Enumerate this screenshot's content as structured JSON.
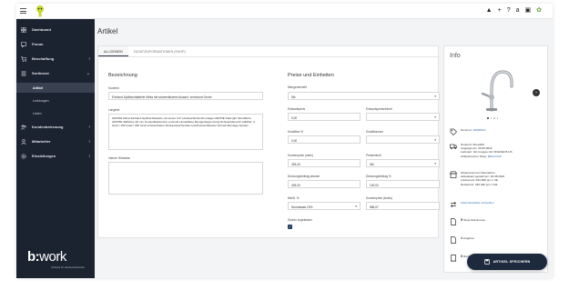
{
  "nav": {
    "items": [
      {
        "label": "Dashboard",
        "icon": "grid-icon"
      },
      {
        "label": "Forum",
        "icon": "chat-icon"
      },
      {
        "label": "Beschaffung",
        "icon": "cart-icon"
      },
      {
        "label": "Sortiment",
        "icon": "sortiment-icon"
      }
    ],
    "subitems": [
      {
        "label": "Artikel",
        "active": true
      },
      {
        "label": "Leistungen"
      },
      {
        "label": "Listen"
      }
    ],
    "items2": [
      {
        "label": "Kundenbetreuung",
        "icon": "people-icon"
      },
      {
        "label": "Mitarbeiter",
        "icon": "person-icon"
      },
      {
        "label": "Einstellungen",
        "icon": "gear-icon"
      }
    ],
    "brand_main": "b:",
    "brand_work": "work",
    "brand_sub": "Software für Handwerksbetriebe"
  },
  "page": {
    "title": "Artikel"
  },
  "tabs": [
    "ALLGEMEIN",
    "ZUSATZINFORMATIONEN (SHOP)"
  ],
  "left": {
    "section": "Bezeichnung",
    "kurztext_label": "Kurztext",
    "kurztext_value": "Einhand-Spültischbatterie Minta mit schwenkbarem Auslauf, verchromt Grohe",
    "langtext_label": "Langtext",
    "langtext_value": "GROHE Minta Einhand-Spültischbatterie mit einem 1/2\"+Auslauf Einlochmontage GROHE StarLight Oberfläche GROHE SilkMove 46 mm Keramikkartusche versenkt einstellbare Mengenbegrenzung Schwenkbereich wählbar: 0 Grad / 150 Grad / 360 Grad schwenkbarer Rohrauslauf flexible Anschlussschläuche Schnell-Montage-System",
    "hints_label": "Interne Hinweise",
    "hints_value": ""
  },
  "right": {
    "section": "Preise und Einheiten",
    "mengeneinheit_label": "Mengeneinheit",
    "mengeneinheit_value": "Stk",
    "einkaufspreis_label": "Einkaufspreis",
    "einkaufspreis_value": "0,00",
    "ekpe_label": "Einkaufspreiseinheit",
    "ekpe_value": "",
    "kondition_label": "Kondition %",
    "kondition_value": "0,00",
    "konditionsart_label": "Konditionsart",
    "konditionsart_value": "",
    "kundenpreis_label": "Kundenpreis (netto)",
    "kundenpreis_value": "493,00",
    "preiseinheit_label": "Preiseinheit",
    "preiseinheit_value": "Stk",
    "db_abs_label": "Deckungsbeitrag absolut",
    "db_abs_value": "493,00",
    "db_pct_label": "Deckungsbeitrag %",
    "db_pct_value": "100,00",
    "mwst_label": "MwSt. %",
    "mwst_value": "Normalsatz 19%",
    "kp_brutto_label": "Kundenpreis (brutto)",
    "kp_brutto_value": "586,67",
    "skonto_label": "Skonto zugelassen",
    "skonto_checked": "✓"
  },
  "info": {
    "title": "Info",
    "nummer_label": "Nummer:",
    "nummer_value": "30000016",
    "herkunft_lines": [
      "Herkunft: Shop200",
      "Angelegt am: 29.08.2022",
      "Lieferant: GC-Gruppe GC ONLINE PLUS",
      "Artikelnummer Shop:"
    ],
    "herkunft_link": "MES-F200",
    "shop_lines": [
      "Shoppreise bei Übernahme",
      "Aktualisiert gestellt am: 29.08.2022",
      "Listenpreis: 493,00€ pro 1 Stk",
      "Nettopreis: 246,34€ pro 1 Stk"
    ],
    "alternatives_link": "Alternativartikel vorhanden",
    "docs_count": "5",
    "docs_label": "Shop Dokumente",
    "angebot_count": "1",
    "angebot_label": "Angebot",
    "rechnungen_count": "0",
    "rechnungen_label": "Rechnungen"
  },
  "save_button": "ARTIKEL SPEICHERN",
  "colors": {
    "sidebar": "#1c2330",
    "accent": "#1d2a3e",
    "link": "#2c6fb8"
  }
}
